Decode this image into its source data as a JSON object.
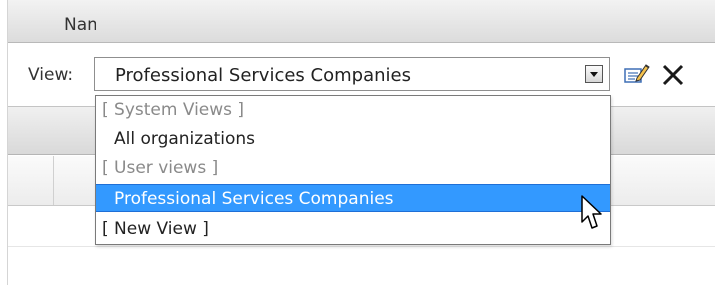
{
  "view_selector": {
    "label": "View:",
    "selected_value": "Professional Services Companies"
  },
  "dropdown": {
    "items": [
      {
        "kind": "group",
        "label": "[ System Views ]"
      },
      {
        "kind": "option",
        "label": "All organizations"
      },
      {
        "kind": "group",
        "label": "[ User views ]"
      },
      {
        "kind": "option",
        "label": "Professional Services Companies",
        "highlighted": true
      },
      {
        "kind": "action",
        "label": "[ New View ]"
      }
    ]
  },
  "grid": {
    "first_column_header": "Name"
  },
  "icons": {
    "edit_view": "edit-view-icon",
    "delete_view": "delete-view-icon",
    "cursor": "mouse-pointer-icon"
  },
  "colors": {
    "highlight": "#3399ff",
    "group_text": "#8a8a8a"
  }
}
